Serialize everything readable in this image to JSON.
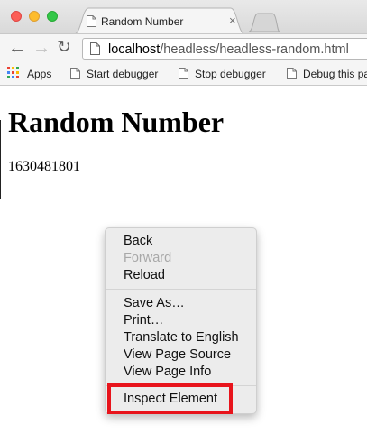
{
  "window": {
    "tab_title": "Random Number",
    "tab_close_glyph": "×"
  },
  "toolbar": {
    "back_glyph": "←",
    "forward_glyph": "→",
    "reload_glyph": "↻",
    "url_host": "localhost",
    "url_path": "/headless/headless-random.html"
  },
  "bookmarks": {
    "items": [
      {
        "label": "Apps",
        "icon": "apps-grid-icon"
      },
      {
        "label": "Start debugger",
        "icon": "page-icon"
      },
      {
        "label": "Stop debugger",
        "icon": "page-icon"
      },
      {
        "label": "Debug this pa",
        "icon": "page-icon"
      }
    ]
  },
  "page": {
    "heading": "Random Number",
    "number": "1630481801"
  },
  "context_menu": {
    "back": "Back",
    "forward": "Forward",
    "reload": "Reload",
    "save_as": "Save As…",
    "print": "Print…",
    "translate": "Translate to English",
    "view_source": "View Page Source",
    "view_info": "View Page Info",
    "inspect": "Inspect Element"
  },
  "colors": {
    "highlight": "#e8141c",
    "close_light": "#fc5f57",
    "minimize_light": "#fdbc2e",
    "zoom_light": "#33c748"
  }
}
